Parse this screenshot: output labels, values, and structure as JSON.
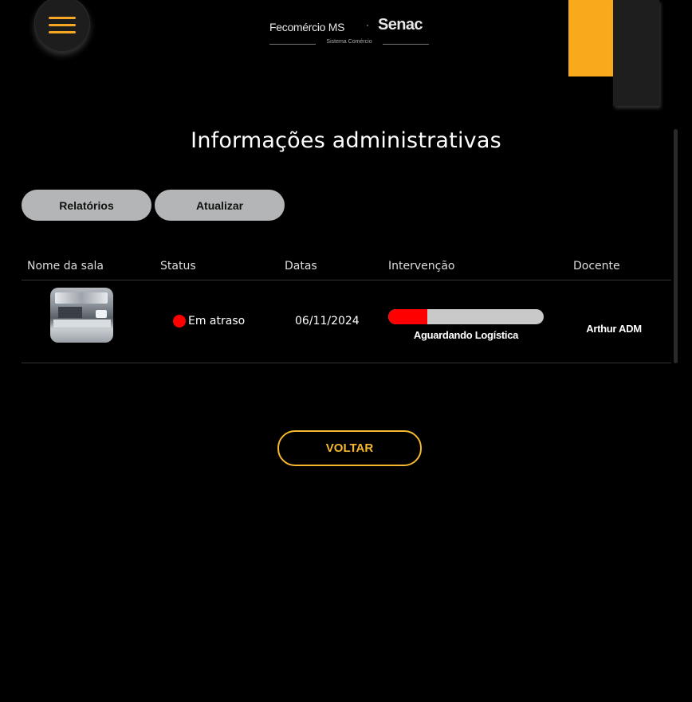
{
  "header": {
    "logo": {
      "brand_left": "Fecomércio MS",
      "separator": "·",
      "brand_right": "Senac",
      "subtitle": "Sistema Comércio"
    },
    "menu_icon": "hamburger-icon",
    "accent_color": "#f9a91c"
  },
  "page": {
    "title": "Informações administrativas"
  },
  "toolbar": {
    "reports_label": "Relatórios",
    "update_label": "Atualizar"
  },
  "table": {
    "columns": [
      "Nome da sala",
      "Status",
      "Datas",
      "Intervenção",
      "Docente"
    ],
    "rows": [
      {
        "room_image": "kitchen-photo",
        "status": "Em atraso",
        "status_color": "#ff0000",
        "date": "06/11/2024",
        "intervention_progress": 0.25,
        "intervention_label": "Aguardando Logística",
        "teacher": "Arthur ADM"
      }
    ]
  },
  "footer": {
    "back_label": "VOLTAR"
  }
}
